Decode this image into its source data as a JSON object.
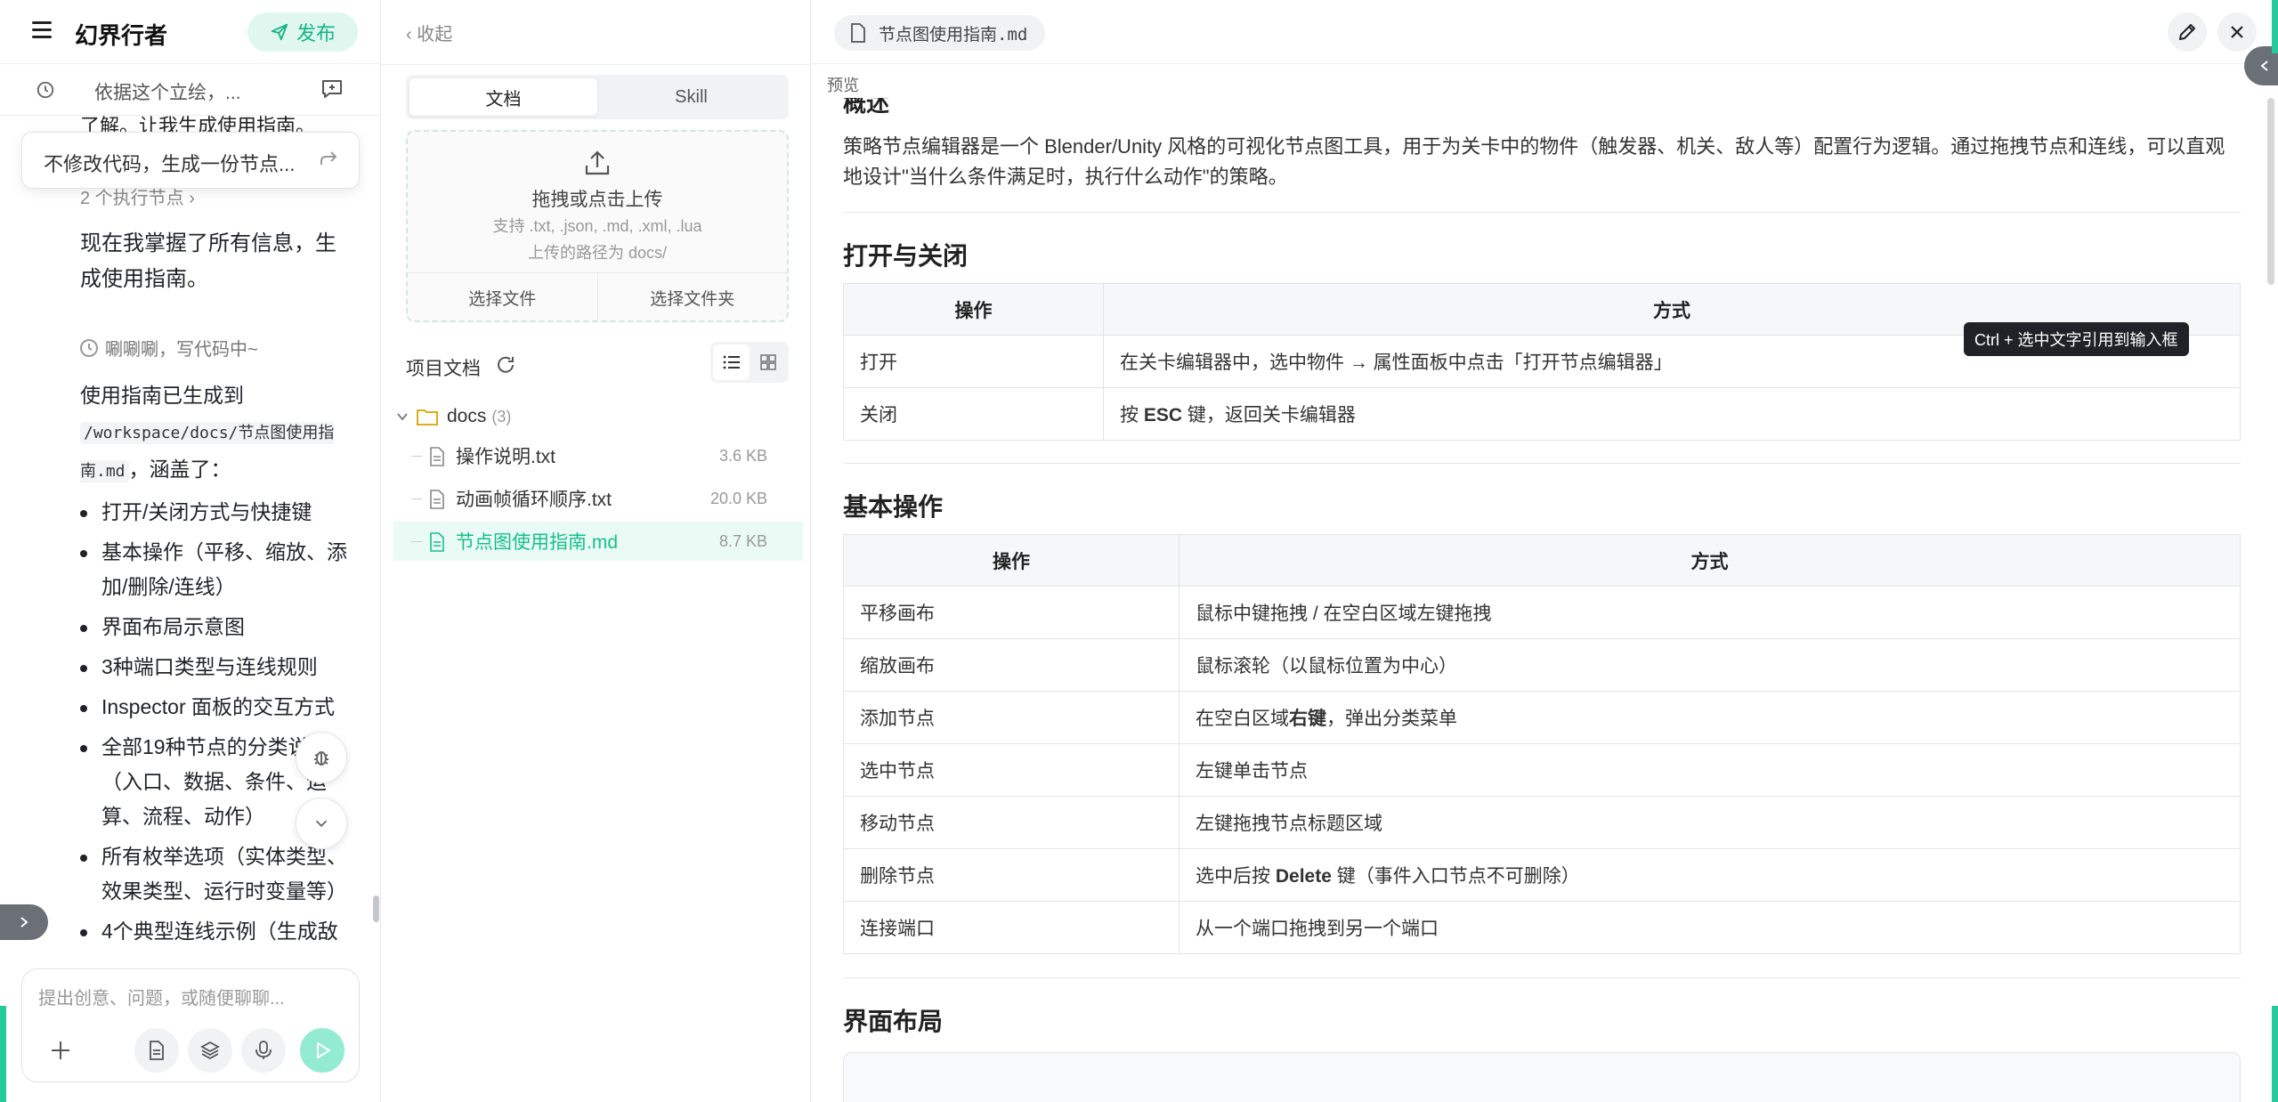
{
  "app": {
    "title": "幻界行者",
    "publish_label": "发布"
  },
  "session": {
    "title": "依据这个立绘，..."
  },
  "quote_card": {
    "text": "不修改代码，生成一份节点..."
  },
  "chat": {
    "partial_top": "了解。让我生成使用指南。",
    "exec_nodes": "2 个执行节点  ›",
    "message_1": "现在我掌握了所有信息，生成使用指南。",
    "status": "唰唰唰，写代码中~",
    "message_2_prefix": "使用指南已生成到",
    "message_2_path": "/workspace/docs/节点图使用指南.md",
    "message_2_suffix": "，涵盖了：",
    "bullets": [
      "打开/关闭方式与快捷键",
      "基本操作（平移、缩放、添加/删除/连线）",
      "界面布局示意图",
      "3种端口类型与连线规则",
      "Inspector 面板的交互方式",
      "全部19种节点的分类说明（入口、数据、条件、运算、流程、动作）",
      "所有枚举选项（实体类型、效果类型、运行时变量等）",
      "4个典型连线示例（生成敌"
    ],
    "composer_placeholder": "提出创意、问题，或随便聊聊..."
  },
  "files": {
    "collapse_label": "‹ 收起",
    "tabs": [
      {
        "label": "文档",
        "active": true
      },
      {
        "label": "Skill",
        "active": false
      }
    ],
    "upload": {
      "title": "拖拽或点击上传",
      "formats": "支持 .txt, .json, .md, .xml, .lua",
      "path": "上传的路径为 docs/",
      "choose_file": "选择文件",
      "choose_folder": "选择文件夹"
    },
    "project_docs_title": "项目文档",
    "folder": {
      "name": "docs",
      "count": "(3)"
    },
    "items": [
      {
        "name": "操作说明.txt",
        "size": "3.6 KB",
        "active": false
      },
      {
        "name": "动画帧循环顺序.txt",
        "size": "20.0 KB",
        "active": false
      },
      {
        "name": "节点图使用指南.md",
        "size": "8.7 KB",
        "active": true
      }
    ]
  },
  "preview": {
    "file_tab": "节点图使用指南.md",
    "label": "预览",
    "partial_heading": "概述",
    "intro": "策略节点编辑器是一个 Blender/Unity 风格的可视化节点图工具，用于为关卡中的物件（触发器、机关、敌人等）配置行为逻辑。通过拖拽节点和连线，可以直观地设计\"当什么条件满足时，执行什么动作\"的策略。",
    "tooltip": "Ctrl + 选中文字引用到输入框",
    "section_open_close": {
      "heading": "打开与关闭",
      "headers": [
        "操作",
        "方式"
      ],
      "rows": [
        {
          "op": "打开",
          "method": "在关卡编辑器中，选中物件 → 属性面板中点击「打开节点编辑器」"
        },
        {
          "op": "关闭",
          "method_pre": "按 ",
          "method_bold": "ESC",
          "method_post": " 键，返回关卡编辑器"
        }
      ]
    },
    "section_basic": {
      "heading": "基本操作",
      "headers": [
        "操作",
        "方式"
      ],
      "rows": [
        {
          "op": "平移画布",
          "method": "鼠标中键拖拽 / 在空白区域左键拖拽"
        },
        {
          "op": "缩放画布",
          "method": "鼠标滚轮（以鼠标位置为中心）"
        },
        {
          "op": "添加节点",
          "method_pre": "在空白区域",
          "method_bold": "右键",
          "method_post": "，弹出分类菜单"
        },
        {
          "op": "选中节点",
          "method": "左键单击节点"
        },
        {
          "op": "移动节点",
          "method": "左键拖拽节点标题区域"
        },
        {
          "op": "删除节点",
          "method_pre": "选中后按 ",
          "method_bold": "Delete",
          "method_post": " 键（事件入口节点不可删除）"
        },
        {
          "op": "连接端口",
          "method": "从一个端口拖拽到另一个端口"
        }
      ]
    },
    "section_layout": {
      "heading": "界面布局"
    }
  },
  "colors": {
    "accent": "#26c99a",
    "accent_text": "#16c08c",
    "publish_bg": "#dff7ef"
  }
}
